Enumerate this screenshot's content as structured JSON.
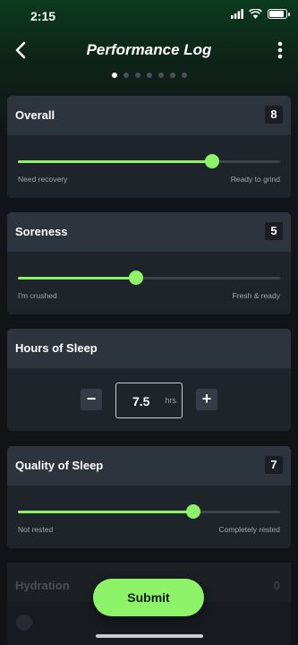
{
  "status_bar": {
    "time": "2:15"
  },
  "header": {
    "title": "Performance Log"
  },
  "pager": {
    "count": 7,
    "active": 0
  },
  "colors": {
    "accent": "#8df46a",
    "card": "#1f242b",
    "card_header": "#2e343d"
  },
  "cards": {
    "overall": {
      "title": "Overall",
      "value": "8",
      "low_label": "Need recovery",
      "high_label": "Ready to grind",
      "level": 0.74
    },
    "soreness": {
      "title": "Soreness",
      "value": "5",
      "low_label": "I'm crushed",
      "high_label": "Fresh & ready",
      "level": 0.45
    },
    "hours_of_sleep": {
      "title": "Hours of Sleep",
      "value": "7.5",
      "unit": "hrs",
      "minus": "−",
      "plus": "+"
    },
    "quality_of_sleep": {
      "title": "Quality of Sleep",
      "value": "7",
      "low_label": "Not rested",
      "high_label": "Completely rested",
      "level": 0.67
    },
    "hydration": {
      "title": "Hydration",
      "value": "0"
    }
  },
  "submit_label": "Submit"
}
